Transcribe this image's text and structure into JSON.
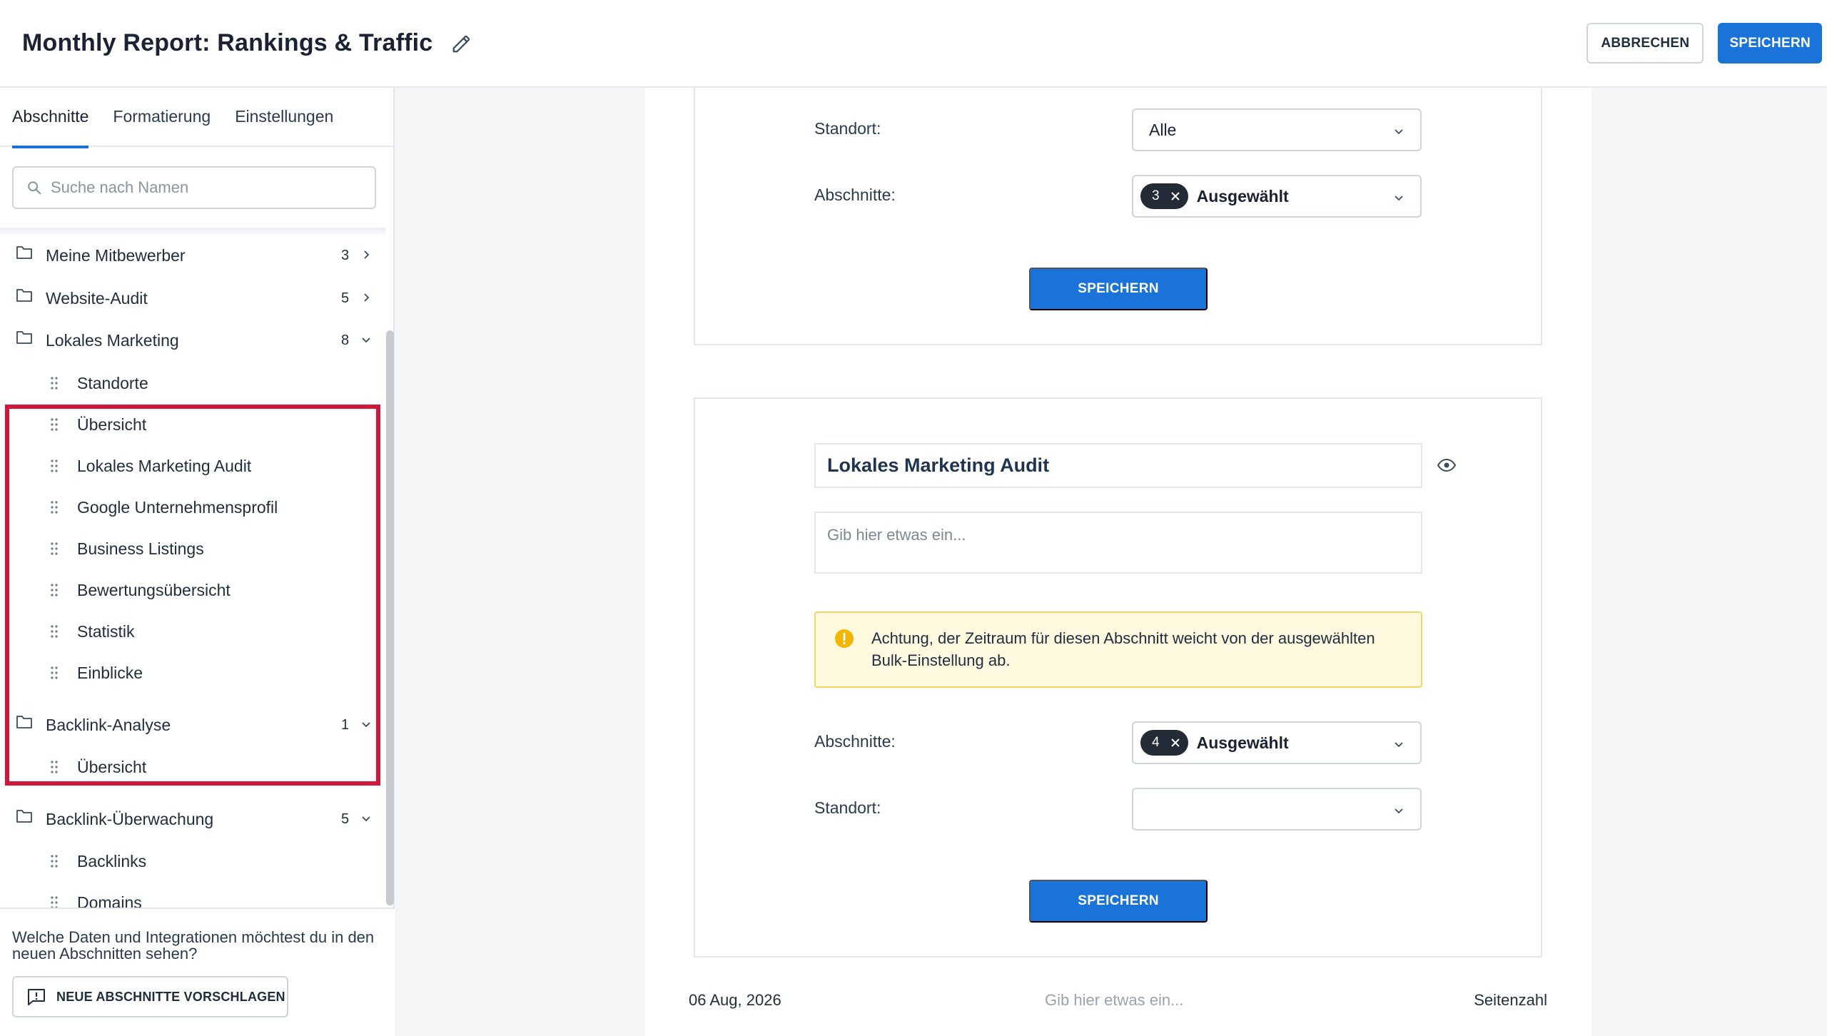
{
  "header": {
    "title": "Monthly Report: Rankings & Traffic",
    "cancel_label": "ABBRECHEN",
    "save_label": "SPEICHERN"
  },
  "sidebar": {
    "tabs": [
      {
        "label": "Abschnitte",
        "active": true
      },
      {
        "label": "Formatierung",
        "active": false
      },
      {
        "label": "Einstellungen",
        "active": false
      }
    ],
    "search_placeholder": "Suche nach Namen",
    "folders": [
      {
        "name": "Meine Mitbewerber",
        "count": "3",
        "expanded": false,
        "items": []
      },
      {
        "name": "Website-Audit",
        "count": "5",
        "expanded": false,
        "items": []
      },
      {
        "name": "Lokales Marketing",
        "count": "8",
        "expanded": true,
        "items": [
          "Standorte",
          "Übersicht",
          "Lokales Marketing Audit",
          "Google Unternehmensprofil",
          "Business Listings",
          "Bewertungsübersicht",
          "Statistik",
          "Einblicke"
        ]
      },
      {
        "name": "Backlink-Analyse",
        "count": "1",
        "expanded": true,
        "items": [
          "Übersicht"
        ]
      },
      {
        "name": "Backlink-Überwachung",
        "count": "5",
        "expanded": true,
        "items": [
          "Backlinks",
          "Domains"
        ]
      }
    ],
    "suggest_question": "Welche Daten und Integrationen möchtest du in den neuen Abschnitten sehen?",
    "suggest_button": "NEUE ABSCHNITTE VORSCHLAGEN"
  },
  "main": {
    "card1": {
      "location_label": "Standort:",
      "location_value": "Alle",
      "sections_label": "Abschnitte:",
      "sections_count": "3",
      "sections_value": "Ausgewählt",
      "save_label": "SPEICHERN"
    },
    "card2": {
      "title": "Lokales Marketing Audit",
      "text_placeholder": "Gib hier etwas ein...",
      "warning": "Achtung, der Zeitraum für diesen Abschnitt weicht von der ausgewählten Bulk-Einstellung ab.",
      "sections_label": "Abschnitte:",
      "sections_count": "4",
      "sections_value": "Ausgewählt",
      "location_label": "Standort:",
      "location_value": "",
      "save_label": "SPEICHERN"
    },
    "footer": {
      "date": "06 Aug, 2026",
      "placeholder": "Gib hier etwas ein...",
      "page_number": "Seitenzahl"
    }
  },
  "colors": {
    "primary": "#1a73d9",
    "highlight": "#d3173a",
    "warning_bg": "#fff9e0",
    "warning_icon": "#f2b705"
  },
  "icons": [
    "pencil-icon",
    "search-icon",
    "folder-icon",
    "chevron-right-icon",
    "chevron-down-icon",
    "drag-handle-icon",
    "close-icon",
    "eye-icon",
    "warning-icon",
    "feedback-icon"
  ]
}
